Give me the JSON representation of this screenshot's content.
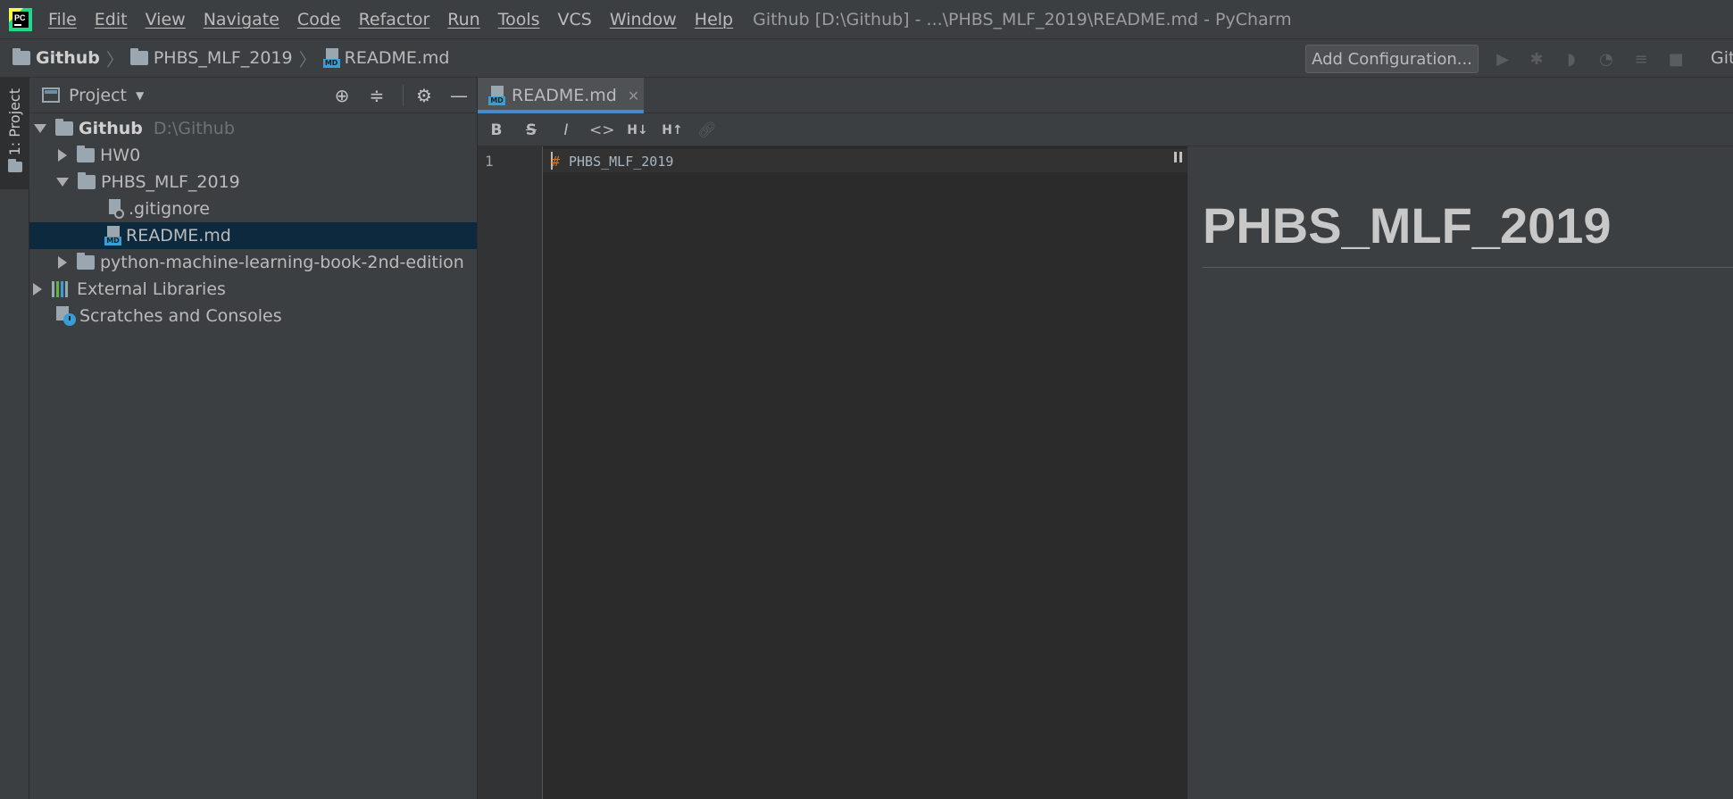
{
  "menubar": {
    "logo_text": "PC",
    "items": [
      "File",
      "Edit",
      "View",
      "Navigate",
      "Code",
      "Refactor",
      "Run",
      "Tools",
      "VCS",
      "Window",
      "Help"
    ],
    "window_title": "Github [D:\\Github] - ...\\PHBS_MLF_2019\\README.md - PyCharm"
  },
  "navbar": {
    "crumbs": [
      "Github",
      "PHBS_MLF_2019",
      "README.md"
    ],
    "add_configuration": "Add Configuration...",
    "git_label": "Git",
    "run_tools": [
      "run-icon",
      "debug-icon",
      "coverage-icon",
      "profile-icon",
      "run-concurrency-icon",
      "stop-icon"
    ]
  },
  "left_strip": {
    "tab_label": "1: Project"
  },
  "project_panel": {
    "title": "Project",
    "tree": {
      "root": {
        "label": "Github",
        "path": "D:\\Github"
      },
      "hw0": "HW0",
      "phbs": "PHBS_MLF_2019",
      "gitignore": ".gitignore",
      "readme": "README.md",
      "book": "python-machine-learning-book-2nd-edition",
      "external_libraries": "External Libraries",
      "scratches": "Scratches and Consoles"
    }
  },
  "editor": {
    "tab_label": "README.md",
    "toolbar": {
      "bold": "B",
      "strike": "S",
      "italic": "I",
      "code": "<>",
      "h_down": "H↓",
      "h_up": "H↑"
    },
    "line_number": "1",
    "code_hash": "#",
    "code_text": "PHBS_MLF_2019"
  },
  "preview": {
    "heading": "PHBS_MLF_2019"
  },
  "colors": {
    "background": "#3c3f41",
    "editor_background": "#2b2b2b",
    "selection": "#0d293e",
    "accent": "#4a88c7",
    "markdown_hash": "#cc7832"
  }
}
